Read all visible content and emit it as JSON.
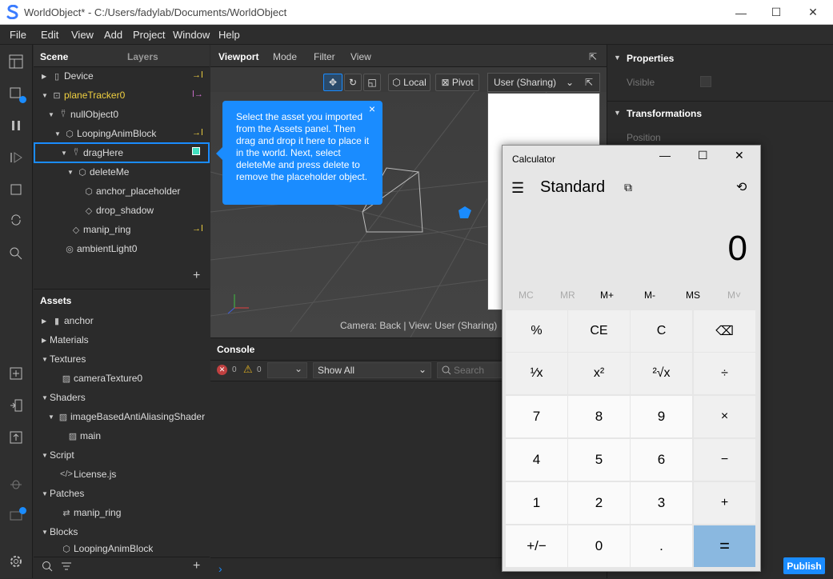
{
  "window": {
    "title": "WorldObject* - C:/Users/fadylab/Documents/WorldObject",
    "minimize": "—",
    "maximize": "☐",
    "close": "✕"
  },
  "menu": [
    "File",
    "Edit",
    "View",
    "Add",
    "Project",
    "Window",
    "Help"
  ],
  "scene": {
    "tab_scene": "Scene",
    "tab_layers": "Layers",
    "items": [
      {
        "label": "Device"
      },
      {
        "label": "planeTracker0"
      },
      {
        "label": "nullObject0"
      },
      {
        "label": "LoopingAnimBlock"
      },
      {
        "label": "dragHere"
      },
      {
        "label": "deleteMe"
      },
      {
        "label": "anchor_placeholder"
      },
      {
        "label": "drop_shadow"
      },
      {
        "label": "manip_ring"
      },
      {
        "label": "ambientLight0"
      }
    ],
    "add": "+"
  },
  "assets": {
    "title": "Assets",
    "items": [
      {
        "label": "anchor"
      },
      {
        "label": "Materials"
      },
      {
        "label": "Textures"
      },
      {
        "label": "cameraTexture0"
      },
      {
        "label": "Shaders"
      },
      {
        "label": "imageBasedAntiAliasingShader"
      },
      {
        "label": "main"
      },
      {
        "label": "Script"
      },
      {
        "label": "License.js"
      },
      {
        "label": "Patches"
      },
      {
        "label": "manip_ring"
      },
      {
        "label": "Blocks"
      },
      {
        "label": "LoopingAnimBlock"
      }
    ]
  },
  "viewport": {
    "tabs": [
      "Viewport",
      "Mode",
      "Filter",
      "View"
    ],
    "local": "Local",
    "pivot": "Pivot",
    "camera_select": "User (Sharing)",
    "status": "Camera: Back | View: User (Sharing)"
  },
  "tooltip": {
    "text": "Select the asset you imported from the Assets panel. Then drag and drop it here to place it in the world. Next, select deleteMe and press delete to remove the placeholder object.",
    "close": "×"
  },
  "console": {
    "title": "Console",
    "errors": "0",
    "warnings": "0",
    "filter": "Show All",
    "search_placeholder": "Search"
  },
  "properties": {
    "title": "Properties",
    "visible": "Visible",
    "transformations": "Transformations",
    "position": "Position"
  },
  "calculator": {
    "title": "Calculator",
    "mode": "Standard",
    "display": "0",
    "memory": [
      "MC",
      "MR",
      "M+",
      "M-",
      "MS",
      "M˅"
    ],
    "keys": [
      [
        "%",
        "CE",
        "C",
        "⌫"
      ],
      [
        "¹⁄x",
        "x²",
        "²√x",
        "÷"
      ],
      [
        "7",
        "8",
        "9",
        "×"
      ],
      [
        "4",
        "5",
        "6",
        "−"
      ],
      [
        "1",
        "2",
        "3",
        "+"
      ],
      [
        "+/−",
        "0",
        ".",
        "="
      ]
    ]
  },
  "publish": "Publish",
  "colors": {
    "accent": "#1a8cff",
    "yellow": "#f0d040",
    "magenta": "#d070d0"
  }
}
